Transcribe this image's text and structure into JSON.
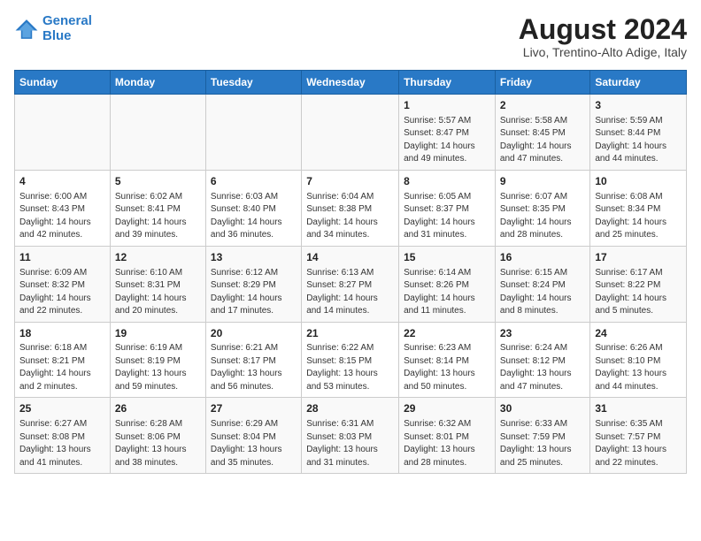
{
  "logo": {
    "line1": "General",
    "line2": "Blue"
  },
  "title": "August 2024",
  "subtitle": "Livo, Trentino-Alto Adige, Italy",
  "days_of_week": [
    "Sunday",
    "Monday",
    "Tuesday",
    "Wednesday",
    "Thursday",
    "Friday",
    "Saturday"
  ],
  "weeks": [
    [
      {
        "num": "",
        "info": ""
      },
      {
        "num": "",
        "info": ""
      },
      {
        "num": "",
        "info": ""
      },
      {
        "num": "",
        "info": ""
      },
      {
        "num": "1",
        "info": "Sunrise: 5:57 AM\nSunset: 8:47 PM\nDaylight: 14 hours and 49 minutes."
      },
      {
        "num": "2",
        "info": "Sunrise: 5:58 AM\nSunset: 8:45 PM\nDaylight: 14 hours and 47 minutes."
      },
      {
        "num": "3",
        "info": "Sunrise: 5:59 AM\nSunset: 8:44 PM\nDaylight: 14 hours and 44 minutes."
      }
    ],
    [
      {
        "num": "4",
        "info": "Sunrise: 6:00 AM\nSunset: 8:43 PM\nDaylight: 14 hours and 42 minutes."
      },
      {
        "num": "5",
        "info": "Sunrise: 6:02 AM\nSunset: 8:41 PM\nDaylight: 14 hours and 39 minutes."
      },
      {
        "num": "6",
        "info": "Sunrise: 6:03 AM\nSunset: 8:40 PM\nDaylight: 14 hours and 36 minutes."
      },
      {
        "num": "7",
        "info": "Sunrise: 6:04 AM\nSunset: 8:38 PM\nDaylight: 14 hours and 34 minutes."
      },
      {
        "num": "8",
        "info": "Sunrise: 6:05 AM\nSunset: 8:37 PM\nDaylight: 14 hours and 31 minutes."
      },
      {
        "num": "9",
        "info": "Sunrise: 6:07 AM\nSunset: 8:35 PM\nDaylight: 14 hours and 28 minutes."
      },
      {
        "num": "10",
        "info": "Sunrise: 6:08 AM\nSunset: 8:34 PM\nDaylight: 14 hours and 25 minutes."
      }
    ],
    [
      {
        "num": "11",
        "info": "Sunrise: 6:09 AM\nSunset: 8:32 PM\nDaylight: 14 hours and 22 minutes."
      },
      {
        "num": "12",
        "info": "Sunrise: 6:10 AM\nSunset: 8:31 PM\nDaylight: 14 hours and 20 minutes."
      },
      {
        "num": "13",
        "info": "Sunrise: 6:12 AM\nSunset: 8:29 PM\nDaylight: 14 hours and 17 minutes."
      },
      {
        "num": "14",
        "info": "Sunrise: 6:13 AM\nSunset: 8:27 PM\nDaylight: 14 hours and 14 minutes."
      },
      {
        "num": "15",
        "info": "Sunrise: 6:14 AM\nSunset: 8:26 PM\nDaylight: 14 hours and 11 minutes."
      },
      {
        "num": "16",
        "info": "Sunrise: 6:15 AM\nSunset: 8:24 PM\nDaylight: 14 hours and 8 minutes."
      },
      {
        "num": "17",
        "info": "Sunrise: 6:17 AM\nSunset: 8:22 PM\nDaylight: 14 hours and 5 minutes."
      }
    ],
    [
      {
        "num": "18",
        "info": "Sunrise: 6:18 AM\nSunset: 8:21 PM\nDaylight: 14 hours and 2 minutes."
      },
      {
        "num": "19",
        "info": "Sunrise: 6:19 AM\nSunset: 8:19 PM\nDaylight: 13 hours and 59 minutes."
      },
      {
        "num": "20",
        "info": "Sunrise: 6:21 AM\nSunset: 8:17 PM\nDaylight: 13 hours and 56 minutes."
      },
      {
        "num": "21",
        "info": "Sunrise: 6:22 AM\nSunset: 8:15 PM\nDaylight: 13 hours and 53 minutes."
      },
      {
        "num": "22",
        "info": "Sunrise: 6:23 AM\nSunset: 8:14 PM\nDaylight: 13 hours and 50 minutes."
      },
      {
        "num": "23",
        "info": "Sunrise: 6:24 AM\nSunset: 8:12 PM\nDaylight: 13 hours and 47 minutes."
      },
      {
        "num": "24",
        "info": "Sunrise: 6:26 AM\nSunset: 8:10 PM\nDaylight: 13 hours and 44 minutes."
      }
    ],
    [
      {
        "num": "25",
        "info": "Sunrise: 6:27 AM\nSunset: 8:08 PM\nDaylight: 13 hours and 41 minutes."
      },
      {
        "num": "26",
        "info": "Sunrise: 6:28 AM\nSunset: 8:06 PM\nDaylight: 13 hours and 38 minutes."
      },
      {
        "num": "27",
        "info": "Sunrise: 6:29 AM\nSunset: 8:04 PM\nDaylight: 13 hours and 35 minutes."
      },
      {
        "num": "28",
        "info": "Sunrise: 6:31 AM\nSunset: 8:03 PM\nDaylight: 13 hours and 31 minutes."
      },
      {
        "num": "29",
        "info": "Sunrise: 6:32 AM\nSunset: 8:01 PM\nDaylight: 13 hours and 28 minutes."
      },
      {
        "num": "30",
        "info": "Sunrise: 6:33 AM\nSunset: 7:59 PM\nDaylight: 13 hours and 25 minutes."
      },
      {
        "num": "31",
        "info": "Sunrise: 6:35 AM\nSunset: 7:57 PM\nDaylight: 13 hours and 22 minutes."
      }
    ]
  ]
}
